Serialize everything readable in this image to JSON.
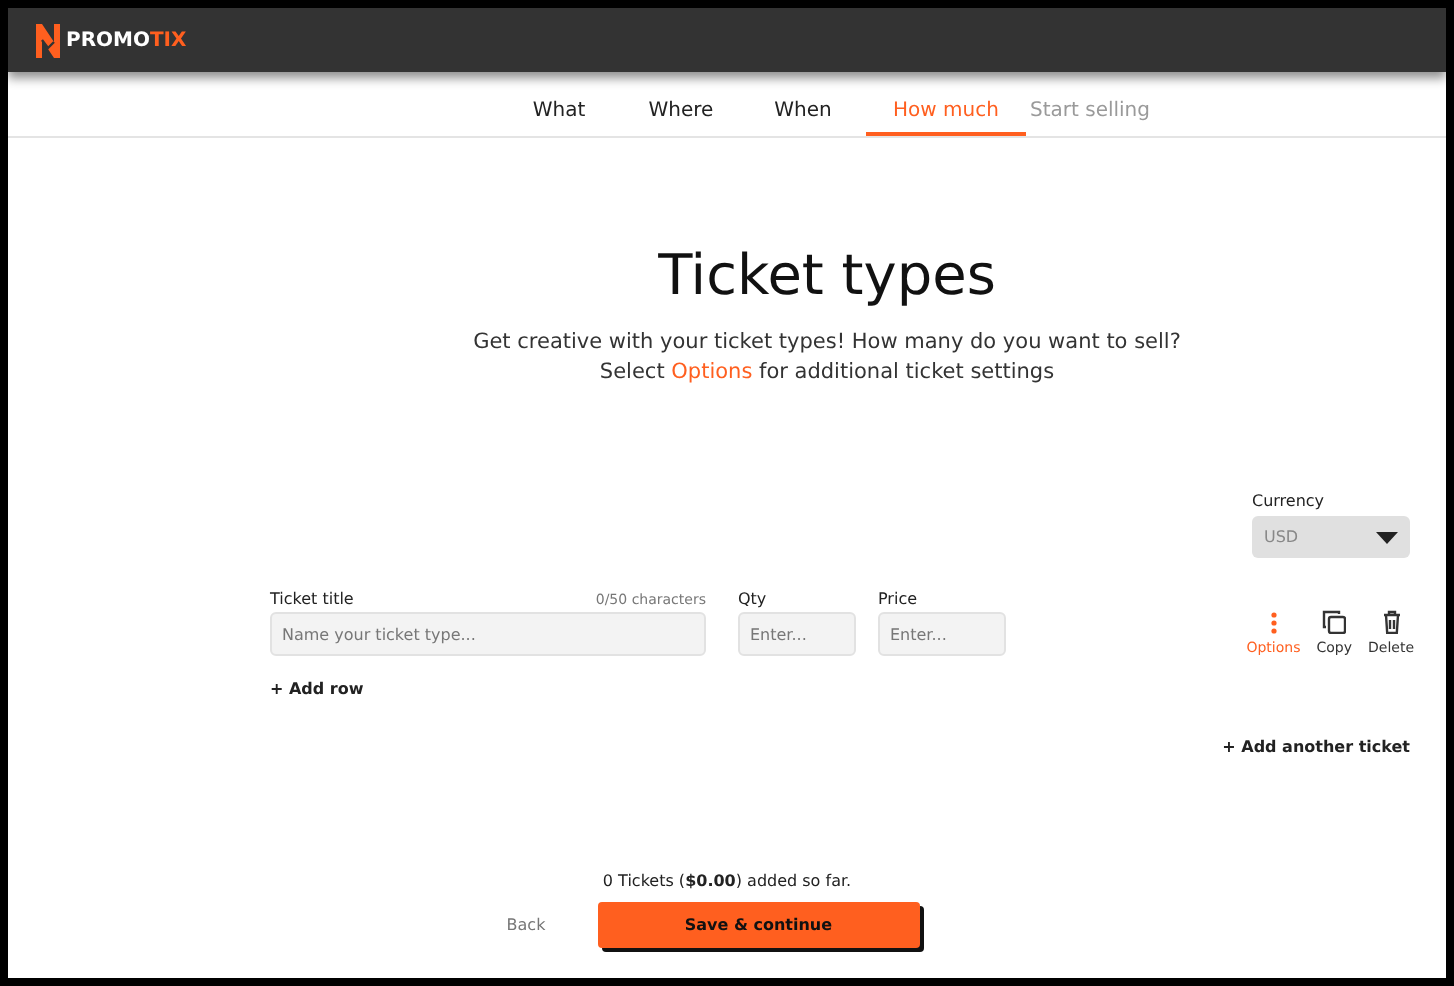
{
  "logo": {
    "parts": [
      {
        "text": "PROMO",
        "accent": false
      },
      {
        "text": "TIX",
        "accent": true
      }
    ]
  },
  "tabs": [
    {
      "label": "What",
      "selected": false,
      "disabled": false
    },
    {
      "label": "Where",
      "selected": false,
      "disabled": false
    },
    {
      "label": "When",
      "selected": false,
      "disabled": false
    },
    {
      "label": "How much",
      "selected": true,
      "disabled": false
    },
    {
      "label": "Start selling",
      "selected": false,
      "disabled": true
    }
  ],
  "heading": "Ticket types",
  "subtitle": {
    "line1": "Get creative with your ticket types! How many do you want to sell?",
    "before": "Select ",
    "link": "Options",
    "after": " for additional ticket settings"
  },
  "currency": {
    "label": "Currency",
    "value": "USD"
  },
  "ticket": {
    "title_label": "Ticket title",
    "counter": "0/50 characters",
    "title_placeholder": "Name your ticket type...",
    "qty_label": "Qty",
    "qty_placeholder": "Enter...",
    "price_label": "Price",
    "price_placeholder": "Enter...",
    "actions": [
      {
        "kind": "options",
        "label": "Options"
      },
      {
        "kind": "copy",
        "label": "Copy"
      },
      {
        "kind": "delete",
        "label": "Delete"
      }
    ]
  },
  "add_row": "+ Add row",
  "add_ticket": "+ Add another ticket",
  "summary": "0 Tickets (**$0.00**) added so far.",
  "buttons": {
    "back": "Back",
    "save": "Save & continue"
  }
}
